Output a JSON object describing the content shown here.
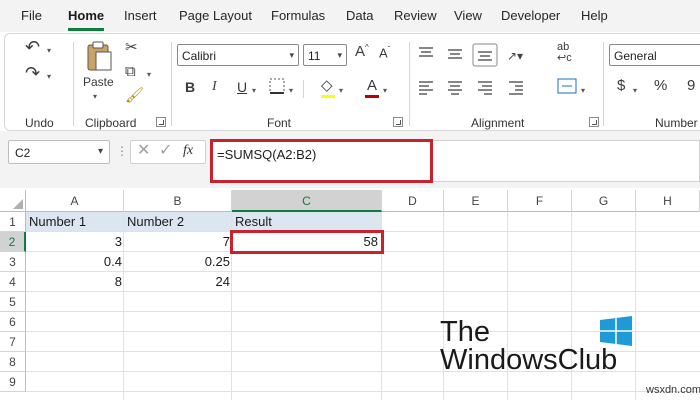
{
  "menu": {
    "tabs": [
      "File",
      "Home",
      "Insert",
      "Page Layout",
      "Formulas",
      "Data",
      "Review",
      "View",
      "Developer",
      "Help"
    ],
    "active": "Home"
  },
  "ribbon": {
    "groups": {
      "undo": "Undo",
      "clipboard": "Clipboard",
      "font": "Font",
      "alignment": "Alignment",
      "number": "Number"
    },
    "paste_label": "Paste",
    "font_name": "Calibri",
    "font_size": "11",
    "number_format": "General",
    "font_color": "#c00000"
  },
  "formula_bar": {
    "name_box": "C2",
    "fx_label": "fx",
    "formula": "=SUMSQ(A2:B2)",
    "highlight_color": "#c8232c"
  },
  "sheet": {
    "columns": [
      "A",
      "B",
      "C",
      "D",
      "E",
      "F",
      "G",
      "H"
    ],
    "rows": [
      "1",
      "2",
      "3",
      "4",
      "5",
      "6",
      "7",
      "8",
      "9"
    ],
    "header_fill": "#dce6f1",
    "cells": {
      "A1": "Number 1",
      "B1": "Number 2",
      "C1": "Result",
      "A2": "3",
      "B2": "7",
      "C2": "58",
      "A3": "0.4",
      "B3": "0.25",
      "A4": "8",
      "B4": "24"
    }
  },
  "watermark": {
    "line1": "The",
    "line2": "WindowsClub",
    "site": "wsxdn.com"
  }
}
